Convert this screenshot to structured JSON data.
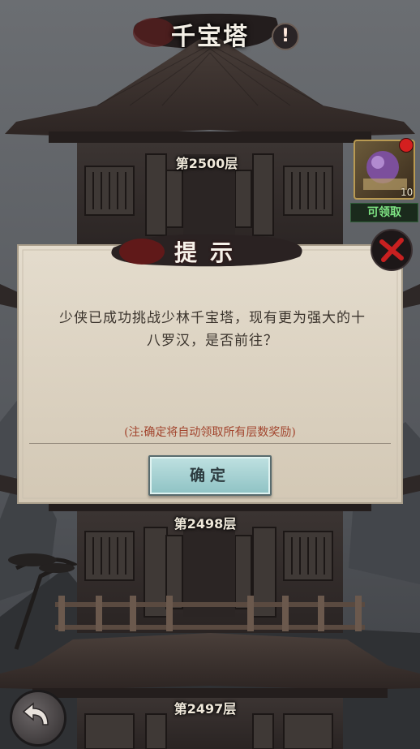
{
  "header": {
    "title": "千宝塔",
    "info_symbol": "!"
  },
  "floors": {
    "top": "第2500层",
    "mid": "第2498层",
    "bottom": "第2497层"
  },
  "reward": {
    "count": "10",
    "claim_label": "可领取"
  },
  "dialog": {
    "title": "提示",
    "message": "少侠已成功挑战少林千宝塔，现有更为强大的十八罗汉，是否前往？",
    "note": "(注:确定将自动领取所有层数奖励)",
    "confirm_label": "确定"
  },
  "colors": {
    "claim_green": "#7fe584",
    "note_red": "#a2452e",
    "button_teal": "#a6d3d4"
  }
}
